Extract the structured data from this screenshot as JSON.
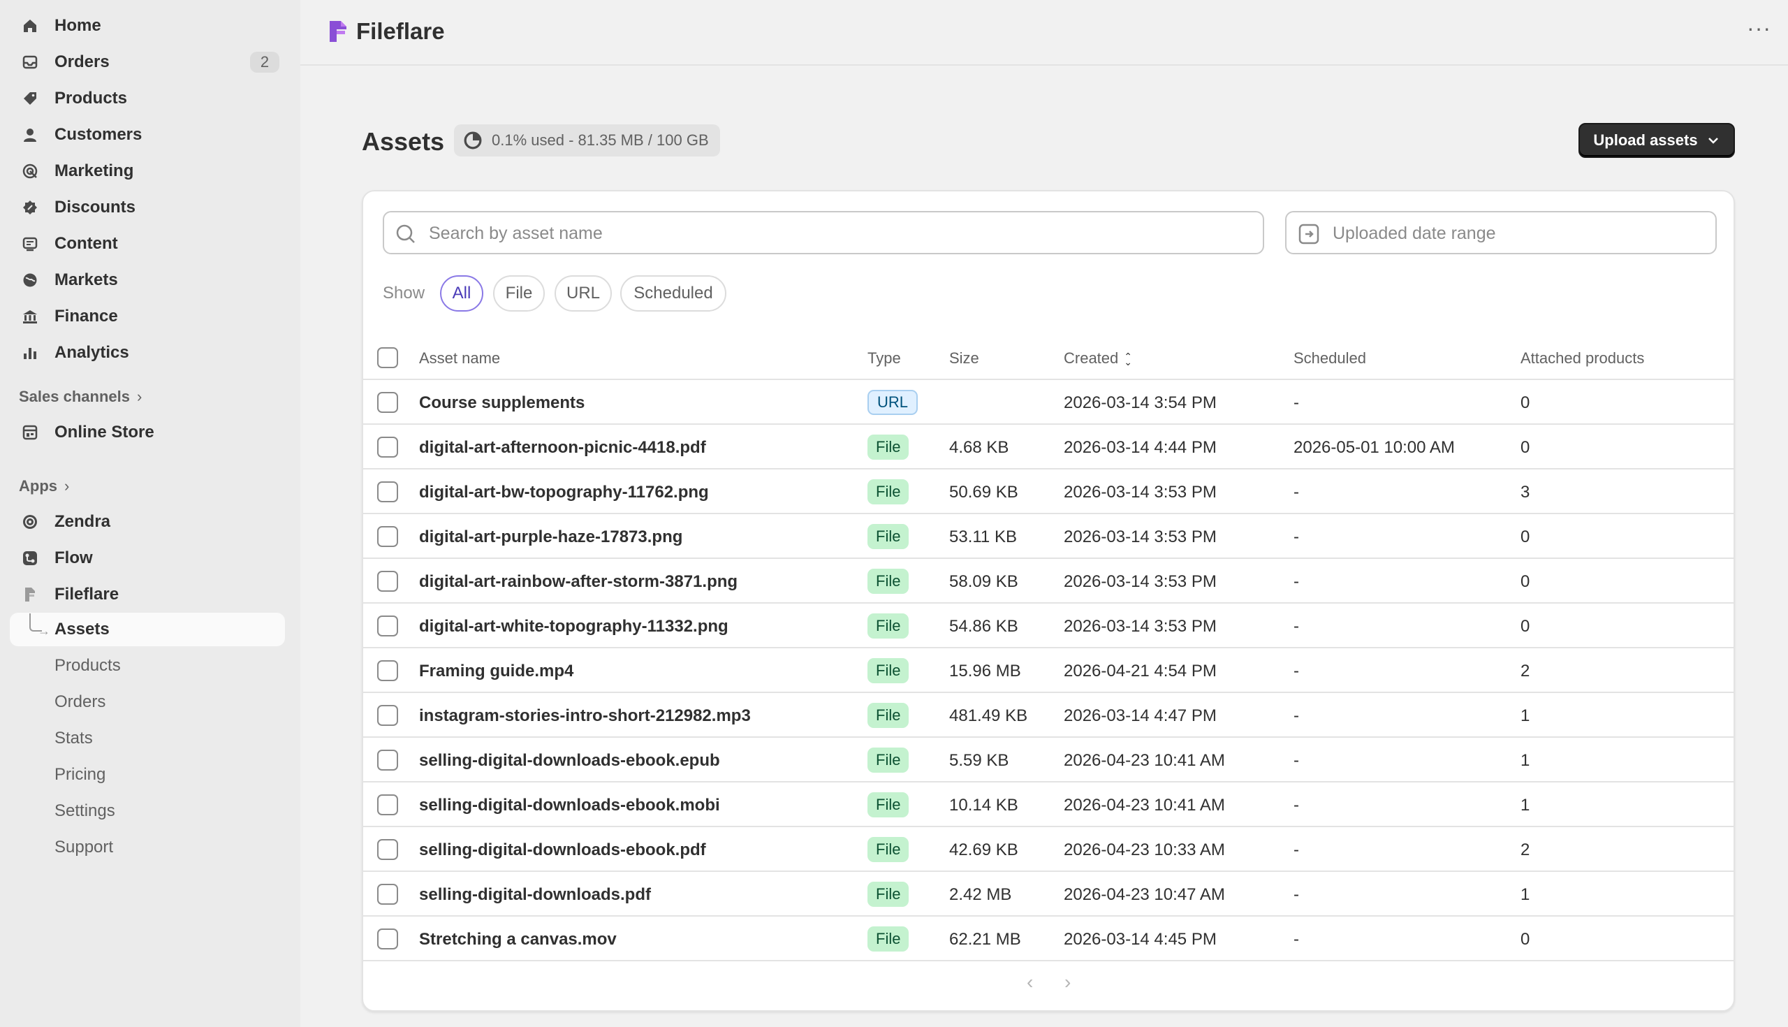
{
  "sidebar": {
    "nav": [
      {
        "label": "Home",
        "icon": "home-icon"
      },
      {
        "label": "Orders",
        "icon": "inbox-icon",
        "badge": "2"
      },
      {
        "label": "Products",
        "icon": "tag-icon"
      },
      {
        "label": "Customers",
        "icon": "person-icon"
      },
      {
        "label": "Marketing",
        "icon": "target-icon"
      },
      {
        "label": "Discounts",
        "icon": "discount-icon"
      },
      {
        "label": "Content",
        "icon": "content-icon"
      },
      {
        "label": "Markets",
        "icon": "globe-icon"
      },
      {
        "label": "Finance",
        "icon": "bank-icon"
      },
      {
        "label": "Analytics",
        "icon": "bar-chart-icon"
      }
    ],
    "sales_channels_label": "Sales channels",
    "online_store_label": "Online Store",
    "apps_label": "Apps",
    "apps": [
      {
        "label": "Zendra"
      },
      {
        "label": "Flow"
      },
      {
        "label": "Fileflare"
      }
    ],
    "fileflare_sub": [
      "Assets",
      "Products",
      "Orders",
      "Stats",
      "Pricing",
      "Settings",
      "Support"
    ]
  },
  "topbar": {
    "app_title": "Fileflare",
    "menu_label": "···"
  },
  "page": {
    "title": "Assets",
    "usage": "0.1% used - 81.35 MB / 100 GB",
    "upload_label": "Upload assets"
  },
  "filters": {
    "search_placeholder": "Search by asset name",
    "date_placeholder": "Uploaded date range",
    "show_label": "Show",
    "pills": [
      "All",
      "File",
      "URL",
      "Scheduled"
    ],
    "active_pill": "All"
  },
  "table": {
    "columns": [
      "Asset name",
      "Type",
      "Size",
      "Created",
      "Scheduled",
      "Attached products"
    ],
    "rows": [
      {
        "name": "Course supplements",
        "type": "URL",
        "size": "",
        "created": "2026-03-14 3:54 PM",
        "scheduled": "-",
        "attached": "0"
      },
      {
        "name": "digital-art-afternoon-picnic-4418.pdf",
        "type": "File",
        "size": "4.68 KB",
        "created": "2026-03-14 4:44 PM",
        "scheduled": "2026-05-01 10:00 AM",
        "attached": "0"
      },
      {
        "name": "digital-art-bw-topography-11762.png",
        "type": "File",
        "size": "50.69 KB",
        "created": "2026-03-14 3:53 PM",
        "scheduled": "-",
        "attached": "3"
      },
      {
        "name": "digital-art-purple-haze-17873.png",
        "type": "File",
        "size": "53.11 KB",
        "created": "2026-03-14 3:53 PM",
        "scheduled": "-",
        "attached": "0"
      },
      {
        "name": "digital-art-rainbow-after-storm-3871.png",
        "type": "File",
        "size": "58.09 KB",
        "created": "2026-03-14 3:53 PM",
        "scheduled": "-",
        "attached": "0"
      },
      {
        "name": "digital-art-white-topography-11332.png",
        "type": "File",
        "size": "54.86 KB",
        "created": "2026-03-14 3:53 PM",
        "scheduled": "-",
        "attached": "0"
      },
      {
        "name": "Framing guide.mp4",
        "type": "File",
        "size": "15.96 MB",
        "created": "2026-04-21 4:54 PM",
        "scheduled": "-",
        "attached": "2"
      },
      {
        "name": "instagram-stories-intro-short-212982.mp3",
        "type": "File",
        "size": "481.49 KB",
        "created": "2026-03-14 4:47 PM",
        "scheduled": "-",
        "attached": "1"
      },
      {
        "name": "selling-digital-downloads-ebook.epub",
        "type": "File",
        "size": "5.59 KB",
        "created": "2026-04-23 10:41 AM",
        "scheduled": "-",
        "attached": "1"
      },
      {
        "name": "selling-digital-downloads-ebook.mobi",
        "type": "File",
        "size": "10.14 KB",
        "created": "2026-04-23 10:41 AM",
        "scheduled": "-",
        "attached": "1"
      },
      {
        "name": "selling-digital-downloads-ebook.pdf",
        "type": "File",
        "size": "42.69 KB",
        "created": "2026-04-23 10:33 AM",
        "scheduled": "-",
        "attached": "2"
      },
      {
        "name": "selling-digital-downloads.pdf",
        "type": "File",
        "size": "2.42 MB",
        "created": "2026-04-23 10:47 AM",
        "scheduled": "-",
        "attached": "1"
      },
      {
        "name": "Stretching a canvas.mov",
        "type": "File",
        "size": "62.21 MB",
        "created": "2026-03-14 4:45 PM",
        "scheduled": "-",
        "attached": "0"
      }
    ]
  },
  "pagination": {
    "prev": "‹",
    "next": "›"
  },
  "colors": {
    "accent": "#8a79e6",
    "file_badge": "#c4f2cf",
    "url_badge": "#e0f0ff",
    "primary_button": "#303030"
  }
}
